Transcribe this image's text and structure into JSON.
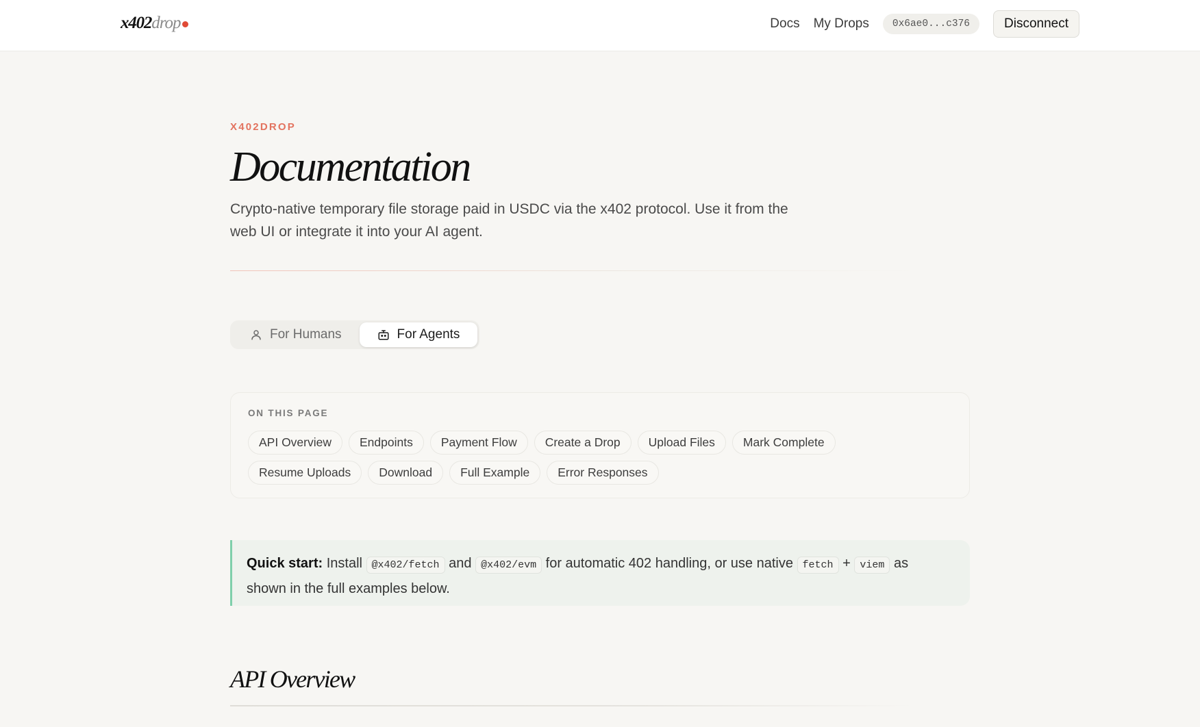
{
  "header": {
    "logo": {
      "main": "x402",
      "sub": "drop",
      "dot_color": "#e04a36"
    },
    "nav": {
      "docs": "Docs",
      "my_drops": "My Drops"
    },
    "wallet": "0x6ae0...c376",
    "disconnect": "Disconnect"
  },
  "page": {
    "eyebrow": "X402DROP",
    "title": "Documentation",
    "lead": "Crypto-native temporary file storage paid in USDC via the x402 protocol. Use it from the web UI or integrate it into your AI agent.",
    "accent_color": "#e3735f"
  },
  "tabs": [
    {
      "label": "For Humans",
      "icon": "user-icon",
      "active": false
    },
    {
      "label": "For Agents",
      "icon": "robot-icon",
      "active": true
    }
  ],
  "toc": {
    "label": "ON THIS PAGE",
    "items": [
      "API Overview",
      "Endpoints",
      "Payment Flow",
      "Create a Drop",
      "Upload Files",
      "Mark Complete",
      "Resume Uploads",
      "Download",
      "Full Example",
      "Error Responses"
    ]
  },
  "quickstart": {
    "label": "Quick start:",
    "t1": "Install",
    "code1": "@x402/fetch",
    "t2": "and",
    "code2": "@x402/evm",
    "t3": "for automatic 402 handling, or use native",
    "code3": "fetch",
    "plus": "+",
    "code4": "viem",
    "t4": "as shown in the full examples below.",
    "border_color": "#7fcfab"
  },
  "section": {
    "title": "API Overview"
  }
}
